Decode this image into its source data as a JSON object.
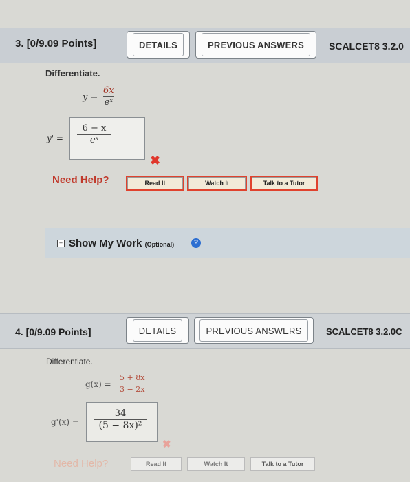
{
  "q3": {
    "number": "3.",
    "points": "[0/9.09 Points]",
    "details_label": "DETAILS",
    "previous_answers_label": "PREVIOUS ANSWERS",
    "code": "SCALCET8 3.2.0",
    "instruction": "Differentiate.",
    "given_lhs": "y =",
    "given_num": "6x",
    "given_den": "eˣ",
    "answer_lhs": "y' =",
    "answer_num": "6 − x",
    "answer_den": "eˣ",
    "need_help": "Need Help?",
    "read_it": "Read It",
    "watch_it": "Watch It",
    "talk_tutor": "Talk to a Tutor",
    "show_my_work": "Show My Work",
    "optional": "(Optional)",
    "help_glyph": "?"
  },
  "q4": {
    "number": "4.",
    "points": "[0/9.09 Points]",
    "details_label": "DETAILS",
    "previous_answers_label": "PREVIOUS ANSWERS",
    "code": "SCALCET8 3.2.0C",
    "instruction": "Differentiate.",
    "given_lhs": "g(x) =",
    "given_num": "5 + 8x",
    "given_den": "3 − 2x",
    "answer_lhs": "g'(x) =",
    "answer_num": "34",
    "answer_den": "(5 − 8x)²",
    "need_help": "Need Help?",
    "read_it": "Read It",
    "watch_it": "Watch It",
    "talk_tutor": "Talk to a Tutor"
  },
  "icons": {
    "wrong": "✖",
    "expand": "+"
  }
}
